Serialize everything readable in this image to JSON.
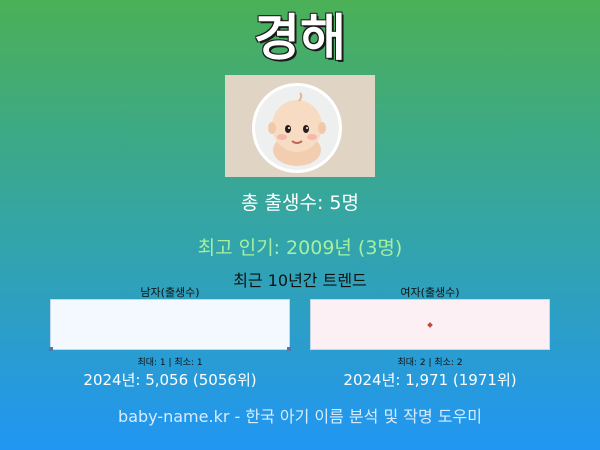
{
  "name": {
    "title": "경해"
  },
  "avatar": {
    "icon": "baby-face-icon"
  },
  "stats": {
    "total_births": "총 출생수: 5명",
    "peak": "최고 인기: 2009년 (3명)"
  },
  "trend": {
    "title": "최근 10년간 트렌드",
    "male": {
      "label": "남자(출생수)",
      "minmax": "최대: 1 | 최소: 1",
      "latest": "2024년: 5,056 (5056위)"
    },
    "female": {
      "label": "여자(출생수)",
      "minmax": "최대: 2 | 최소: 2",
      "latest": "2024년: 1,971 (1971위)"
    }
  },
  "footer": {
    "text": "baby-name.kr - 한국 아기 이름 분석 및 작명 도우미"
  },
  "colors": {
    "gradient_top": "#4bb056",
    "gradient_bottom": "#2196f3",
    "peak_text": "#a6f0a0",
    "male_chart_bg": "#f4f8ff",
    "female_chart_bg": "#fdf0f4",
    "female_point": "#c24b3c"
  }
}
